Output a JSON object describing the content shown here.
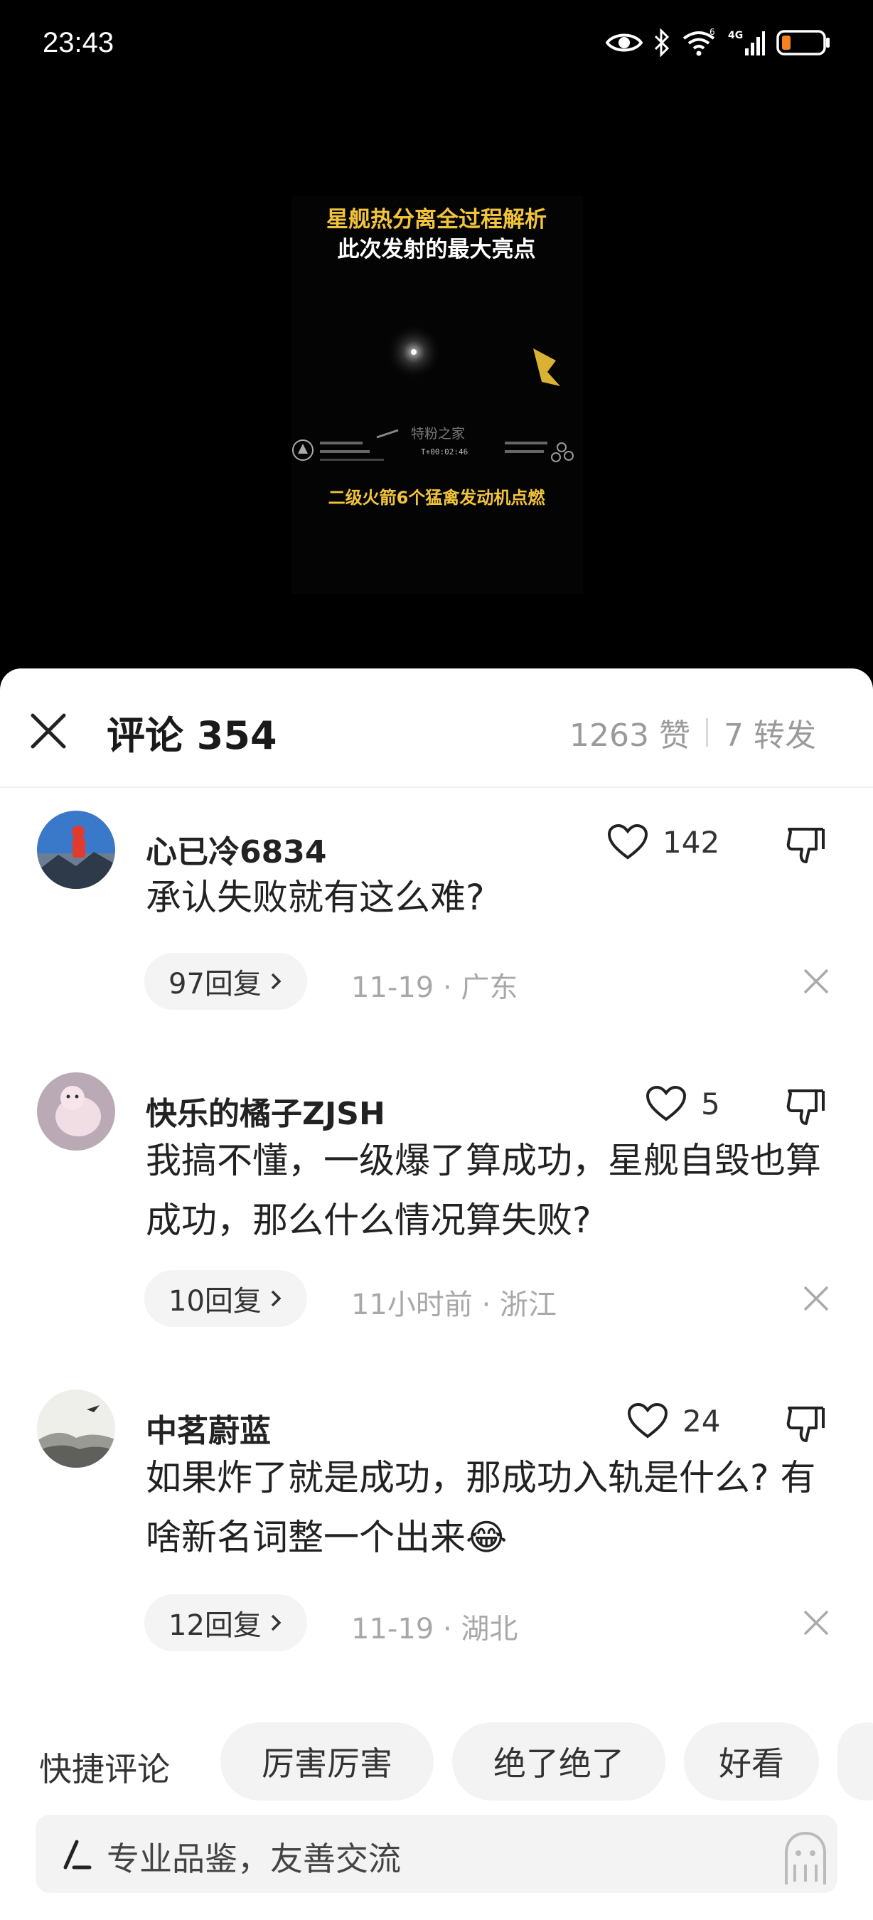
{
  "status_bar": {
    "time": "23:43",
    "signal_label": "4G",
    "wifi_label": "6"
  },
  "video": {
    "caption_line1": "星舰热分离全过程解析",
    "caption_line2": "此次发射的最大亮点",
    "caption_bottom": "二级火箭6个猛禽发动机点燃",
    "watermark": "特粉之家",
    "telemetry_time": "T+00:02:46"
  },
  "sheet": {
    "title": "评论 354",
    "likes": "1263 赞",
    "shares": "7 转发"
  },
  "comments": [
    {
      "author": "心已冷6834",
      "text": "承认失败就有这么难?",
      "likes": "142",
      "replies": "97回复",
      "meta": "11-19 · 广东"
    },
    {
      "author": "快乐的橘子ZJSH",
      "text": "我搞不懂，一级爆了算成功，星舰自毁也算成功，那么什么情况算失败?",
      "likes": "5",
      "replies": "10回复",
      "meta": "11小时前 · 浙江"
    },
    {
      "author": "中茗蔚蓝",
      "text": "如果炸了就是成功，那成功入轨是什么? 有啥新名词整一个出来😂",
      "likes": "24",
      "replies": "12回复",
      "meta": "11-19 · 湖北"
    }
  ],
  "quick_comments": {
    "label": "快捷评论",
    "chips": [
      "厉害厉害",
      "绝了绝了",
      "好看"
    ]
  },
  "input": {
    "placeholder": "专业品鉴，友善交流"
  },
  "colors": {
    "caption_yellow": "#f2c43a",
    "sheet_bg": "#ffffff",
    "chip_bg": "#f3f3f3"
  }
}
